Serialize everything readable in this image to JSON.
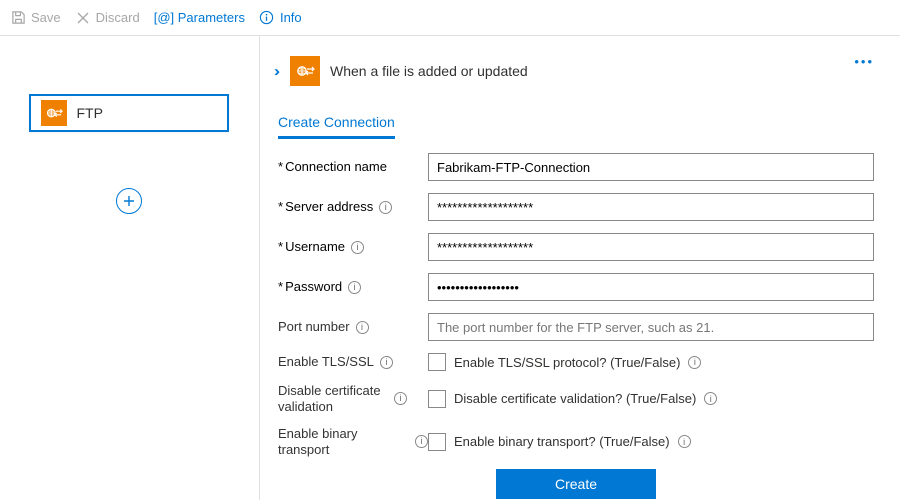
{
  "toolbar": {
    "save": "Save",
    "discard": "Discard",
    "parameters": "[@] Parameters",
    "info": "Info"
  },
  "left": {
    "ftp_label": "FTP"
  },
  "header": {
    "title": "When a file is added or updated"
  },
  "tab": {
    "create_conn": "Create Connection"
  },
  "form": {
    "conn_name_label": "Connection name",
    "conn_name_value": "Fabrikam-FTP-Connection",
    "server_label": "Server address",
    "server_value": "*******************",
    "username_label": "Username",
    "username_value": "*******************",
    "password_label": "Password",
    "password_value": "••••••••••••••••••",
    "port_label": "Port number",
    "port_placeholder": "The port number for the FTP server, such as 21.",
    "tls_label": "Enable TLS/SSL",
    "tls_check_label": "Enable TLS/SSL protocol? (True/False)",
    "cert_label": "Disable certificate validation",
    "cert_check_label": "Disable certificate validation? (True/False)",
    "binary_label": "Enable binary transport",
    "binary_check_label": "Enable binary transport? (True/False)",
    "create_btn": "Create"
  }
}
